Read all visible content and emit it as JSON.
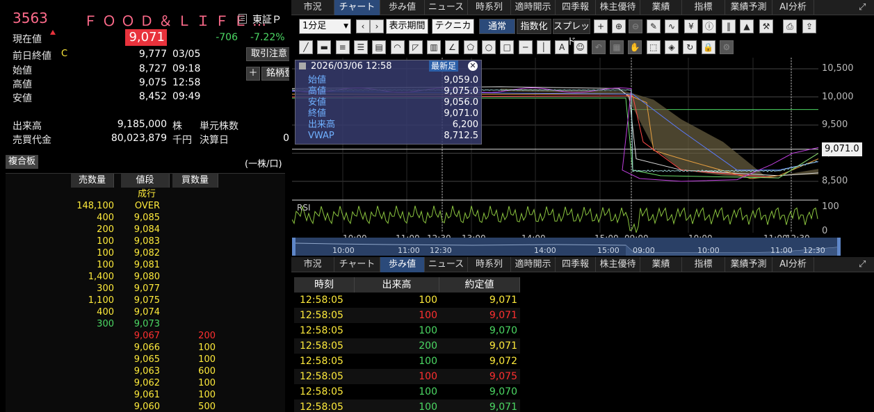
{
  "stock": {
    "code": "3563",
    "name": "ＦＯＯＤ＆ＬＩＦＥ…",
    "exchange": "東証Ｐ"
  },
  "quote": {
    "current_label": "現在値",
    "current": "9,071",
    "change": "-706",
    "change_pct": "-7.22%",
    "prev_label": "前日終値",
    "prev_flag": "C",
    "prev": "9,777",
    "prev_time": "03/05",
    "open_label": "始値",
    "open": "8,727",
    "open_time": "09:18",
    "high_label": "高値",
    "high": "9,075",
    "high_time": "12:58",
    "low_label": "安値",
    "low": "8,452",
    "low_time": "09:49",
    "volume_label": "出来高",
    "volume": "9,185,000",
    "volume_unit": "株",
    "turnover_label": "売買代金",
    "turnover": "80,023,879",
    "turnover_unit": "千円",
    "unit_shares_label": "単元株数",
    "settle_label": "決算日",
    "settle_val": "0"
  },
  "buttons": {
    "trade_note": "取引注意",
    "add_label": "＋",
    "stock_label": "銘柄登"
  },
  "board": {
    "label": "複合板",
    "unit": "(一株/口)",
    "headers": [
      "売数量",
      "値段",
      "買数量"
    ],
    "market_label": "成行",
    "rows": [
      {
        "sell": "148,100",
        "price": "OVER",
        "buy": ""
      },
      {
        "sell": "400",
        "price": "9,085",
        "buy": ""
      },
      {
        "sell": "200",
        "price": "9,084",
        "buy": ""
      },
      {
        "sell": "100",
        "price": "9,083",
        "buy": ""
      },
      {
        "sell": "100",
        "price": "9,082",
        "buy": ""
      },
      {
        "sell": "100",
        "price": "9,081",
        "buy": ""
      },
      {
        "sell": "1,400",
        "price": "9,080",
        "buy": ""
      },
      {
        "sell": "300",
        "price": "9,077",
        "buy": ""
      },
      {
        "sell": "1,100",
        "price": "9,075",
        "buy": ""
      },
      {
        "sell": "400",
        "price": "9,074",
        "buy": ""
      },
      {
        "sell": "300",
        "price": "9,073",
        "buy": "",
        "sell_color": "#4cd964",
        "price_color": "#4cd964"
      },
      {
        "sell": "",
        "price": "9,067",
        "buy": "200",
        "price_color": "#ff3030",
        "buy_color": "#ff3030"
      },
      {
        "sell": "",
        "price": "9,066",
        "buy": "100"
      },
      {
        "sell": "",
        "price": "9,065",
        "buy": "100"
      },
      {
        "sell": "",
        "price": "9,063",
        "buy": "600"
      },
      {
        "sell": "",
        "price": "9,062",
        "buy": "100"
      },
      {
        "sell": "",
        "price": "9,061",
        "buy": "100"
      },
      {
        "sell": "",
        "price": "9,060",
        "buy": "500"
      }
    ]
  },
  "tabs": [
    "市況",
    "チャート",
    "歩み値",
    "ニュース",
    "時系列",
    "適時開示",
    "四季報",
    "株主優待",
    "業績",
    "指標",
    "業績予測",
    "AI分析"
  ],
  "top_active_tab": 1,
  "bottom_active_tab": 2,
  "toolbar": {
    "interval": "1分足",
    "period": "表示期間",
    "technical": "テクニカル",
    "normal": "通常",
    "index": "指数化",
    "spread": "スプレッド"
  },
  "infobox": {
    "datetime": "2026/03/06 12:58",
    "latest": "最新足",
    "rows": [
      [
        "始値",
        "9,059.0"
      ],
      [
        "高値",
        "9,075.0"
      ],
      [
        "安値",
        "9,056.0"
      ],
      [
        "終値",
        "9,071.0"
      ],
      [
        "出来高",
        "6,200"
      ],
      [
        "VWAP",
        "8,712.5"
      ]
    ]
  },
  "chart": {
    "y_ticks": [
      "10,500",
      "10,000",
      "9,500",
      "9,000",
      "8,500"
    ],
    "last_price": "9,071.0",
    "rsi_label": "RSI",
    "rsi_top": "100",
    "rsi_bottom": "0",
    "x_ticks": [
      "10:00",
      "11:00",
      "12:30",
      "13:00",
      "14:00",
      "15:00",
      "09:00",
      "10:00",
      "11:00",
      "12:30"
    ],
    "nav_ticks": [
      "10:00",
      "11:00",
      "12:30",
      "14:00",
      "15:00",
      "09:00",
      "10:00",
      "11:00",
      "12:30"
    ]
  },
  "trades": {
    "headers": [
      "時刻",
      "出来高",
      "約定値"
    ],
    "rows": [
      {
        "time": "12:58:05",
        "vol": "100",
        "price": "9,071",
        "vc": "cy",
        "pc": "cy"
      },
      {
        "time": "12:58:05",
        "vol": "100",
        "price": "9,071",
        "vc": "cr",
        "pc": "cr"
      },
      {
        "time": "12:58:05",
        "vol": "100",
        "price": "9,070",
        "vc": "cg",
        "pc": "cg"
      },
      {
        "time": "12:58:05",
        "vol": "200",
        "price": "9,071",
        "vc": "cg",
        "pc": "cy"
      },
      {
        "time": "12:58:05",
        "vol": "100",
        "price": "9,072",
        "vc": "cg",
        "pc": "cy"
      },
      {
        "time": "12:58:05",
        "vol": "100",
        "price": "9,075",
        "vc": "cr",
        "pc": "cr"
      },
      {
        "time": "12:58:05",
        "vol": "100",
        "price": "9,070",
        "vc": "cg",
        "pc": "cg"
      },
      {
        "time": "12:58:05",
        "vol": "100",
        "price": "9,071",
        "vc": "cg",
        "pc": "cg"
      }
    ]
  }
}
